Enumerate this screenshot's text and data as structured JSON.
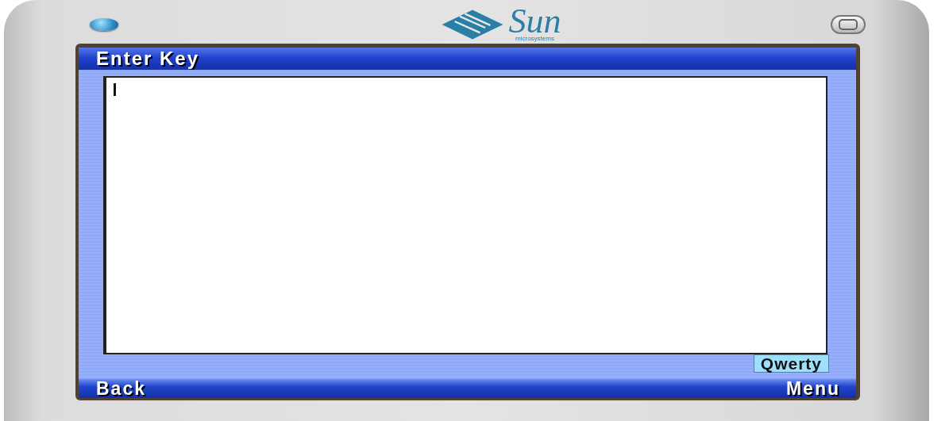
{
  "device": {
    "brand": "Sun",
    "tagline": "microsystems"
  },
  "screen": {
    "title": "Enter Key",
    "text_field": {
      "cursor": true
    },
    "input_mode": "Qwerty",
    "softkeys": {
      "left": "Back",
      "right": "Menu"
    }
  }
}
